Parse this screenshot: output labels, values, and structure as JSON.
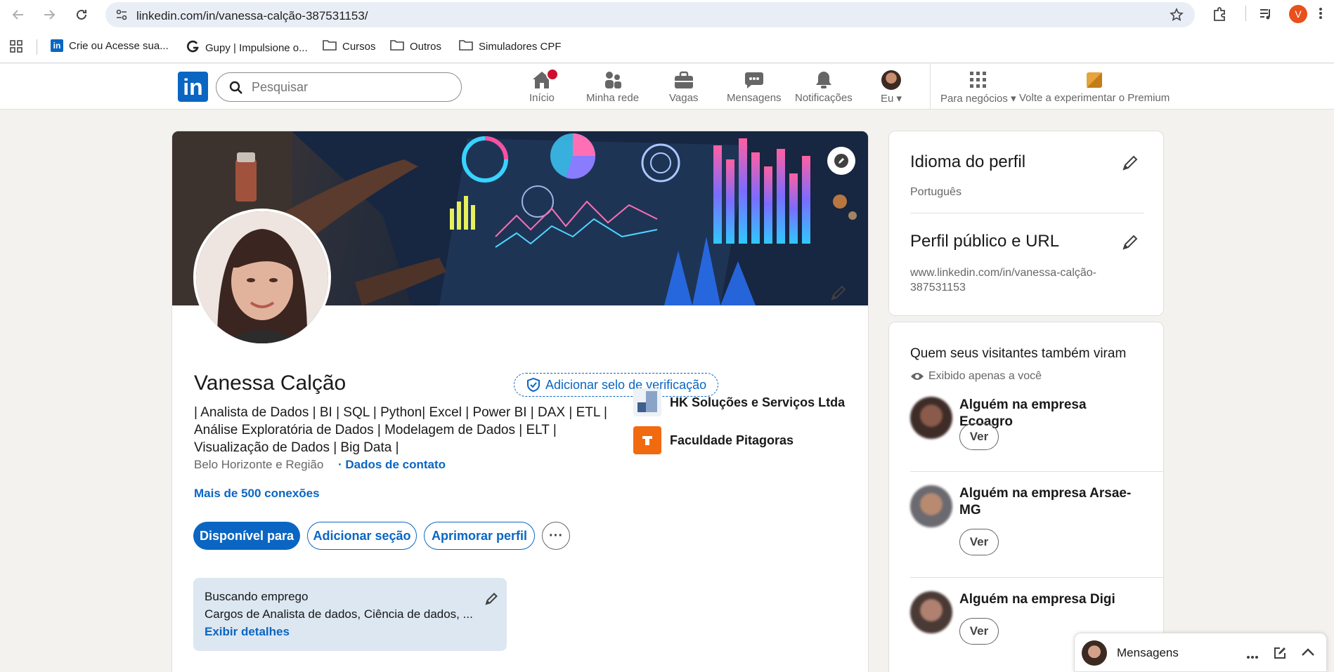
{
  "browser": {
    "url": "linkedin.com/in/vanessa-calção-387531153/",
    "profile_initial": "V",
    "bookmarks": [
      {
        "label": "Crie ou Acesse sua..."
      },
      {
        "label": "Gupy | Impulsione o..."
      },
      {
        "label": "Cursos"
      },
      {
        "label": "Outros"
      },
      {
        "label": "Simuladores CPF"
      }
    ]
  },
  "header": {
    "search_placeholder": "Pesquisar",
    "nav": [
      {
        "label": "Início",
        "icon": "home-icon"
      },
      {
        "label": "Minha rede",
        "icon": "network-icon"
      },
      {
        "label": "Vagas",
        "icon": "briefcase-icon"
      },
      {
        "label": "Mensagens",
        "icon": "messaging-icon"
      },
      {
        "label": "Notificações",
        "icon": "bell-icon"
      },
      {
        "label": "Eu",
        "icon": "avatar"
      },
      {
        "label": "Para negócios",
        "icon": "grid-icon"
      },
      {
        "label": "Volte a experimentar o Premium",
        "icon": "premium-icon"
      }
    ],
    "accent": "#0a66c2"
  },
  "profile": {
    "name": "Vanessa Calção",
    "verify_label": "Adicionar selo de verificação",
    "headline_lines": [
      "| Analista de Dados | BI | SQL | Python| Excel | Power BI | DAX | ETL |",
      "Análise Exploratória de Dados | Modelagem de Dados | ELT |",
      "Visualização de Dados | Big Data |"
    ],
    "location": "Belo Horizonte e Região",
    "contact_label": "· Dados de contato",
    "connections": "Mais de 500 conexões",
    "buttons": {
      "open_to": "Disponível para",
      "add_section": "Adicionar seção",
      "enhance": "Aprimorar perfil",
      "more": "···"
    },
    "experience": [
      {
        "name": "HK Soluções e Serviços Ltda"
      },
      {
        "name": "Faculdade Pitagoras"
      }
    ],
    "open_to_work": {
      "title": "Buscando emprego",
      "details": "Cargos de Analista de dados, Ciência de dados, ...",
      "link": "Exibir detalhes"
    }
  },
  "sidebar": {
    "language_title": "Idioma do perfil",
    "language_value": "Português",
    "url_title": "Perfil público e URL",
    "url_value_line1": "www.linkedin.com/in/vanessa-calção-",
    "url_value_line2": "387531153",
    "visitors_title": "Quem seus visitantes também viram",
    "visitors_sub": "Exibido apenas a você",
    "visitors": [
      {
        "name": "Alguém na empresa Ecoagro",
        "button": "Ver"
      },
      {
        "name": "Alguém na empresa Arsae-MG",
        "button": "Ver"
      },
      {
        "name": "Alguém na empresa Digi",
        "button": "Ver"
      }
    ]
  },
  "messaging": {
    "title": "Mensagens"
  }
}
